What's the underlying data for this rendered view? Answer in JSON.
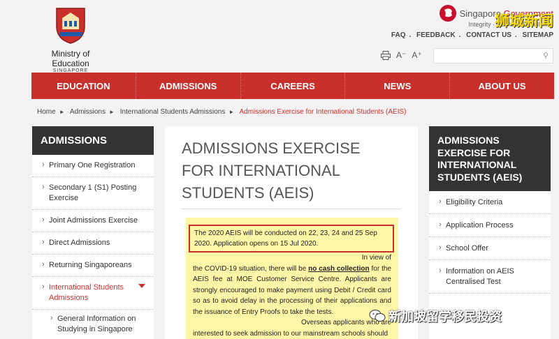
{
  "header": {
    "org_name": "Ministry of Education",
    "org_sub": "SINGAPORE",
    "gov_prefix": "Singapore ",
    "gov_emph": "Government",
    "gov_sub": "Integrity · Service · Excellence",
    "watermark": "狮城新闻",
    "links": [
      "FAQ",
      "FEEDBACK",
      "CONTACT US",
      "SITEMAP"
    ],
    "font_small": "A⁻",
    "font_large": "A⁺",
    "search_placeholder": ""
  },
  "nav": [
    "EDUCATION",
    "ADMISSIONS",
    "CAREERS",
    "NEWS",
    "ABOUT US"
  ],
  "breadcrumb": [
    "Home",
    "Admissions",
    "International Students Admissions"
  ],
  "breadcrumb_current": "Admissions Exercise for International Students (AEIS)",
  "left_sidebar": {
    "title": "ADMISSIONS",
    "items": [
      "Primary One Registration",
      "Secondary 1 (S1) Posting Exercise",
      "Joint Admissions Exercise",
      "Direct Admissions",
      "Returning Singaporeans",
      "International Students Admissions"
    ],
    "sub_items": [
      "General Information on Studying in Singapore"
    ]
  },
  "main": {
    "title": "ADMISSIONS EXERCISE FOR INTERNATIONAL STUDENTS (AEIS)",
    "notice_box": "The 2020 AEIS will be conducted on 22, 23, 24 and 25 Sep 2020. Application opens on 15 Jul 2020.",
    "para1_lead": "In view of",
    "para1_a": "the COVID-19 situation, there will be ",
    "para1_emph": "no cash collection",
    "para1_b": " for the AEIS fee at MOE Customer Service Centre. Applicants are strongly encouraged to make payment using Debit / Credit card so as to avoid delay in the processing of their applications and the issuance of Entry Proofs to take the tests.",
    "para2_lead": "Overseas applicants who are",
    "para2": "interested to seek admission to our mainstream schools should"
  },
  "right_sidebar": {
    "title": "ADMISSIONS EXERCISE FOR INTERNATIONAL STUDENTS (AEIS)",
    "items": [
      "Eligibility Criteria",
      "Application Process",
      "School Offer",
      "Information on AEIS Centralised Test"
    ]
  },
  "watermark_bottom": "新加坡留学移民投资",
  "colors": {
    "accent": "#c9302c",
    "dark": "#333333",
    "notice_bg": "#fff7a8"
  }
}
